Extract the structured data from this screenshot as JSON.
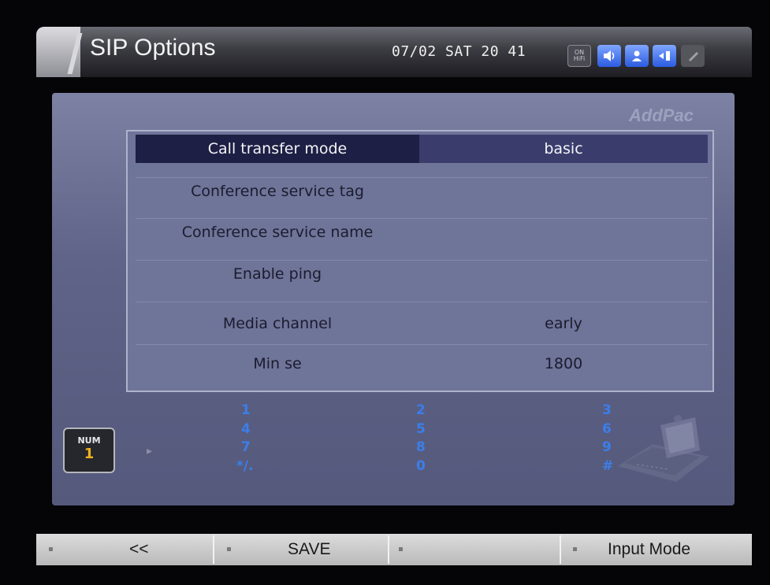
{
  "header": {
    "title": "SIP Options",
    "datetime": "07/02 SAT 20 41",
    "status_icons": [
      {
        "name": "hifi-icon",
        "label_top": "ON",
        "label_bottom": "HiFi"
      },
      {
        "name": "speaker-icon"
      },
      {
        "name": "profile-icon"
      },
      {
        "name": "transfer-icon"
      },
      {
        "name": "handset-icon"
      }
    ]
  },
  "brand": "AddPac",
  "options": [
    {
      "label": "Call transfer mode",
      "value": "basic",
      "selected": true
    },
    {
      "label": "Conference service tag",
      "value": ""
    },
    {
      "label": "Conference service name",
      "value": ""
    },
    {
      "label": "Enable ping",
      "value": ""
    },
    {
      "label": "Media channel",
      "value": "early"
    },
    {
      "label": "Min se",
      "value": "1800"
    }
  ],
  "input_mode": {
    "top": "NUM",
    "bottom": "1"
  },
  "keypad": {
    "col1": [
      "1",
      "4",
      "7",
      "*/."
    ],
    "col2": [
      "2",
      "5",
      "8",
      "0"
    ],
    "col3": [
      "3",
      "6",
      "9",
      "#"
    ]
  },
  "footer": {
    "back": "<<",
    "save": "SAVE",
    "empty": "",
    "input_mode": "Input Mode"
  },
  "colors": {
    "panel": "#5f6488",
    "selected_row": "#1d1f44",
    "keypad_digits": "#3b7eea",
    "accent_icon": "#2b5be0"
  }
}
